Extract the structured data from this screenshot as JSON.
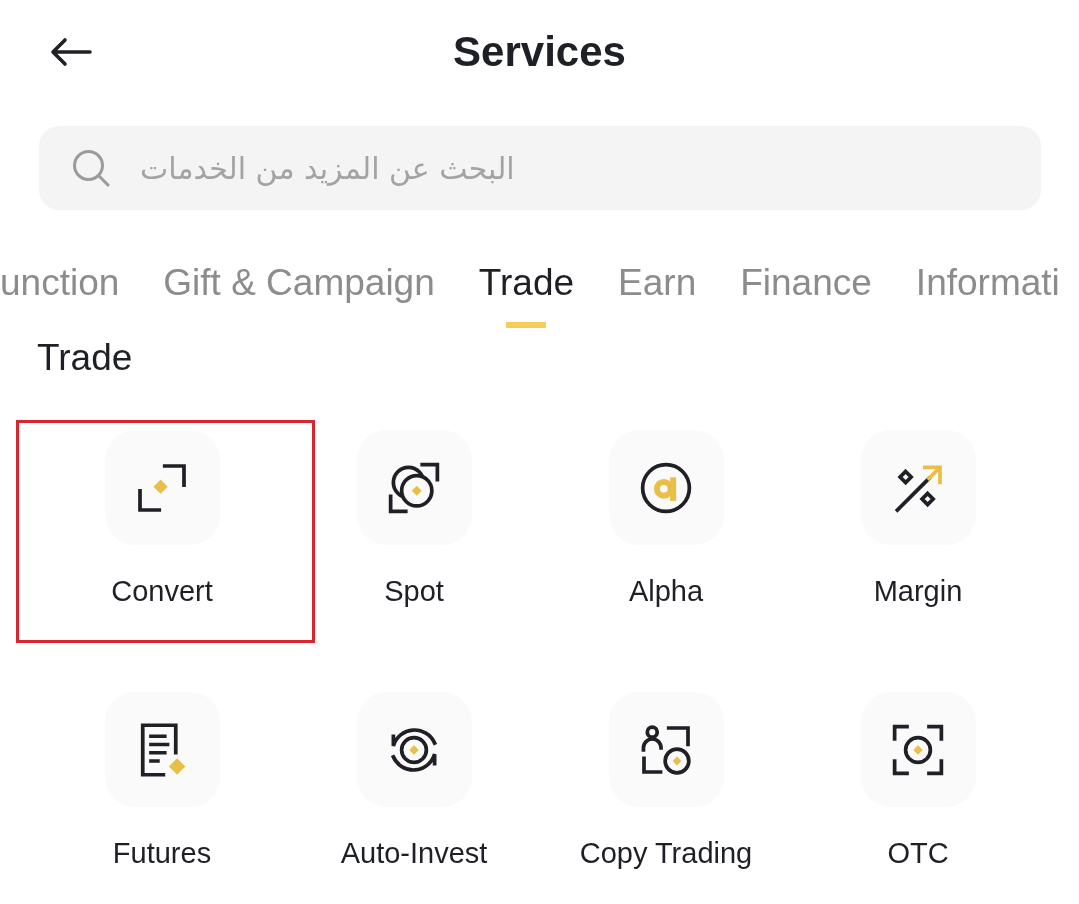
{
  "header": {
    "title": "Services"
  },
  "search": {
    "placeholder": "البحث عن المزيد من الخدمات"
  },
  "tabs": [
    {
      "label": "unction",
      "selected": false
    },
    {
      "label": "Gift & Campaign",
      "selected": false
    },
    {
      "label": "Trade",
      "selected": true
    },
    {
      "label": "Earn",
      "selected": false
    },
    {
      "label": "Finance",
      "selected": false
    },
    {
      "label": "Informati",
      "selected": false
    }
  ],
  "section": {
    "title": "Trade",
    "items": [
      {
        "kind": "convert",
        "label": "Convert",
        "highlighted": true
      },
      {
        "kind": "spot",
        "label": "Spot",
        "highlighted": false
      },
      {
        "kind": "alpha",
        "label": "Alpha",
        "highlighted": false
      },
      {
        "kind": "margin",
        "label": "Margin",
        "highlighted": false
      },
      {
        "kind": "futures",
        "label": "Futures",
        "highlighted": false
      },
      {
        "kind": "auto_invest",
        "label": "Auto-Invest",
        "highlighted": false
      },
      {
        "kind": "copy_trading",
        "label": "Copy Trading",
        "highlighted": false
      },
      {
        "kind": "otc",
        "label": "OTC",
        "highlighted": false
      }
    ]
  }
}
